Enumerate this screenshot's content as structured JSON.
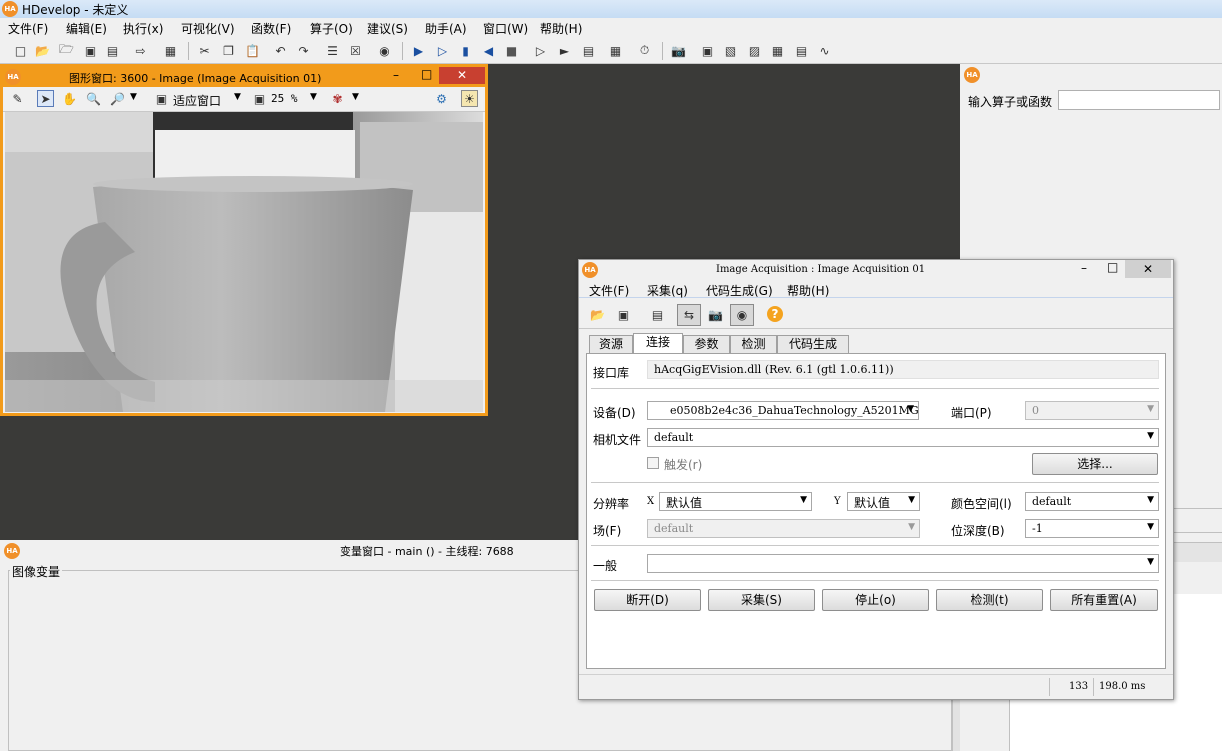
{
  "app": {
    "title": "HDevelop - 未定义",
    "menu": [
      "文件(F)",
      "编辑(E)",
      "执行(x)",
      "可视化(V)",
      "函数(F)",
      "算子(O)",
      "建议(S)",
      "助手(A)",
      "窗口(W)",
      "帮助(H)"
    ]
  },
  "graphics_window": {
    "title": "图形窗口: 3600 - Image (Image Acquisition 01)",
    "fit_label": "适应窗口",
    "zoom_value": "25 %"
  },
  "operator_panel": {
    "input_label": "输入算子或函数",
    "input_value": ""
  },
  "variable_window": {
    "title": "变量窗口 - main () - 主线程: 7688",
    "image_vars_label": "图像变量"
  },
  "dialog": {
    "title": "Image Acquisition : Image Acquisition 01",
    "menu": [
      "文件(F)",
      "采集(q)",
      "代码生成(G)",
      "帮助(H)"
    ],
    "tabs": [
      "资源",
      "连接",
      "参数",
      "检测",
      "代码生成"
    ],
    "interface_label": "接口库",
    "interface_value": "hAcqGigEVision.dll (Rev. 6.1 (gtl 1.0.6.11))",
    "device_label": "设备(D)",
    "device_value": "e0508b2e4c36_DahuaTechnology_A5201MG50",
    "port_label": "端口(P)",
    "port_value": "0",
    "camera_file_label": "相机文件",
    "camera_file_value": "default",
    "trigger_label": "触发(r)",
    "select_button": "选择...",
    "resolution_label": "分辨率",
    "x_label": "X",
    "x_value": "默认值",
    "y_label": "Y",
    "y_value": "默认值",
    "color_space_label": "颜色空间(l)",
    "color_space_value": "default",
    "field_label": "场(F)",
    "field_value": "default",
    "bit_depth_label": "位深度(B)",
    "bit_depth_value": "-1",
    "general_label": "一般",
    "general_value": "",
    "buttons": [
      "断开(D)",
      "采集(S)",
      "停止(o)",
      "检测(t)",
      "所有重置(A)"
    ],
    "status_count": "133",
    "status_time": "198.0 ms"
  }
}
